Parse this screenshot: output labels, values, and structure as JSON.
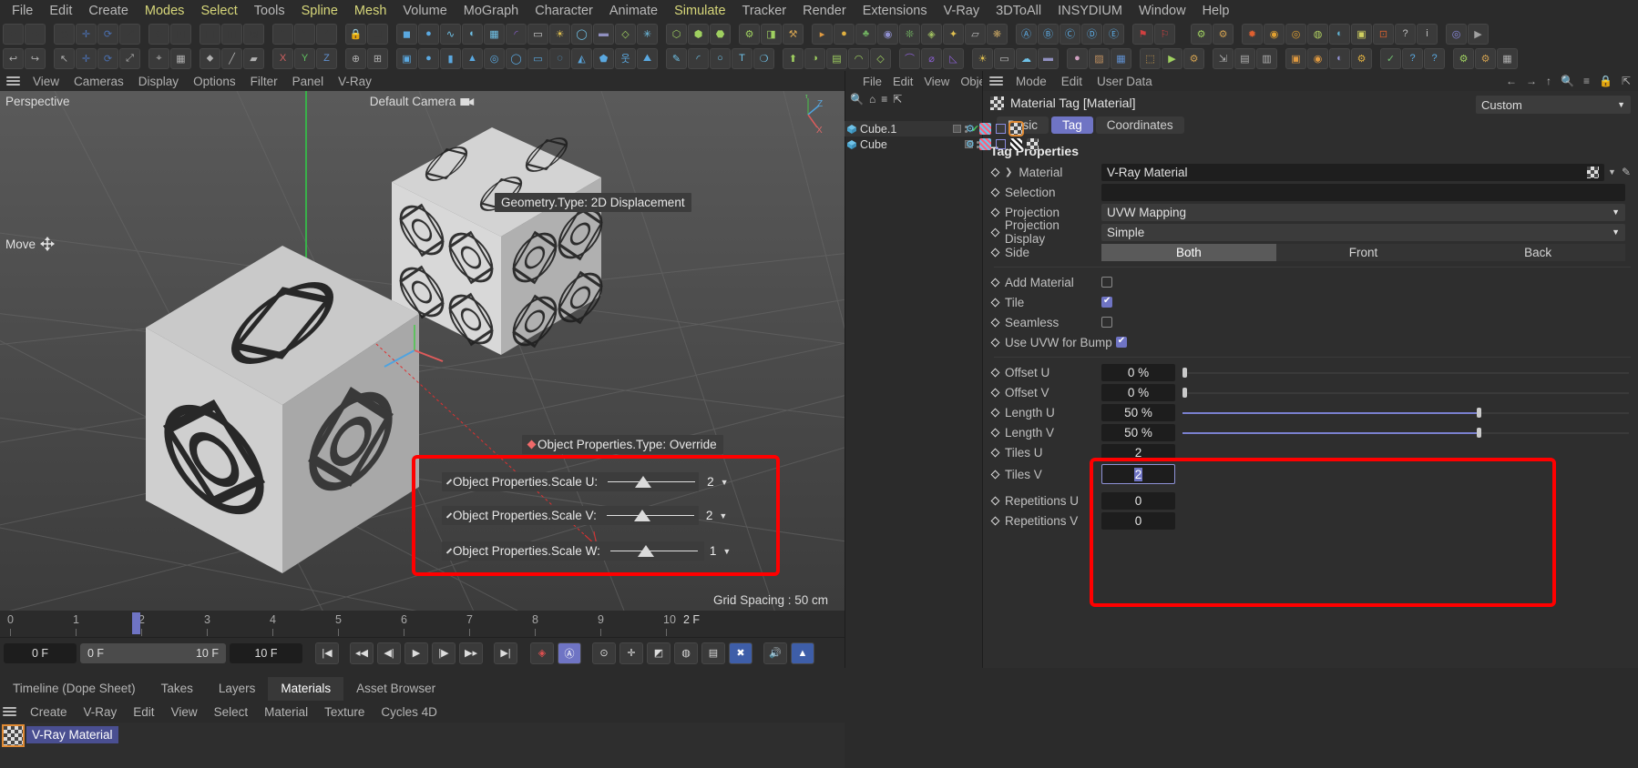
{
  "menubar": {
    "items": [
      {
        "label": "File",
        "accent": false
      },
      {
        "label": "Edit",
        "accent": false
      },
      {
        "label": "Create",
        "accent": false
      },
      {
        "label": "Modes",
        "accent": true
      },
      {
        "label": "Select",
        "accent": true
      },
      {
        "label": "Tools",
        "accent": false
      },
      {
        "label": "Spline",
        "accent": true
      },
      {
        "label": "Mesh",
        "accent": true
      },
      {
        "label": "Volume",
        "accent": false
      },
      {
        "label": "MoGraph",
        "accent": false
      },
      {
        "label": "Character",
        "accent": false
      },
      {
        "label": "Animate",
        "accent": false
      },
      {
        "label": "Simulate",
        "accent": true
      },
      {
        "label": "Tracker",
        "accent": false
      },
      {
        "label": "Render",
        "accent": false
      },
      {
        "label": "Extensions",
        "accent": false
      },
      {
        "label": "V-Ray",
        "accent": false
      },
      {
        "label": "3DToAll",
        "accent": false
      },
      {
        "label": "INSYDIUM",
        "accent": false
      },
      {
        "label": "Window",
        "accent": false
      },
      {
        "label": "Help",
        "accent": false
      }
    ]
  },
  "viewport_menu": {
    "items": [
      "View",
      "Cameras",
      "Display",
      "Options",
      "Filter",
      "Panel",
      "V-Ray"
    ]
  },
  "viewport": {
    "view_label": "Perspective",
    "camera_label": "Default Camera",
    "tool_label": "Move",
    "grid_spacing": "Grid Spacing : 50 cm",
    "axis_x": "X",
    "axis_y": "Y",
    "axis_z": "Z",
    "hud_geometry": "Geometry.Type: 2D Displacement",
    "hud_object_type": "Object Properties.Type: Override",
    "hud_sliders": [
      {
        "label": "Object Properties.Scale U:",
        "value": "2"
      },
      {
        "label": "Object Properties.Scale V:",
        "value": "2"
      },
      {
        "label": "Object Properties.Scale W:",
        "value": "1"
      }
    ]
  },
  "timeline": {
    "ticks": [
      "0",
      "1",
      "2",
      "3",
      "4",
      "5",
      "6",
      "7",
      "8",
      "9",
      "10"
    ],
    "end_label": "2 F",
    "current_frame": "0 F",
    "range_start": "0 F",
    "range_end": "10 F",
    "preview_end": "10 F"
  },
  "object_manager": {
    "menu": [
      "File",
      "Edit",
      "View",
      "Object"
    ],
    "chevron": "›",
    "icons": [
      "search-icon",
      "home-icon",
      "filter-icon",
      "popout-icon"
    ],
    "rows": [
      {
        "name": "Cube.1",
        "selected": true
      },
      {
        "name": "Cube",
        "selected": false
      }
    ]
  },
  "attribute_manager": {
    "menu": [
      "Mode",
      "Edit",
      "User Data"
    ],
    "nav_icons": [
      "back-arrow-icon",
      "forward-arrow-icon",
      "up-arrow-icon",
      "search-icon",
      "filter-icon",
      "lock-icon",
      "popout-icon"
    ],
    "title": "Material Tag [Material]",
    "preset_label": "Custom",
    "tabs": [
      {
        "label": "Basic",
        "active": false
      },
      {
        "label": "Tag",
        "active": true
      },
      {
        "label": "Coordinates",
        "active": false
      }
    ],
    "section_title": "Tag Properties",
    "fields": {
      "material": {
        "label": "Material",
        "value": "V-Ray Material"
      },
      "selection": {
        "label": "Selection",
        "value": ""
      },
      "projection": {
        "label": "Projection",
        "value": "UVW Mapping"
      },
      "projection_display": {
        "label": "Projection Display",
        "value": "Simple"
      },
      "side": {
        "label": "Side",
        "options": [
          "Both",
          "Front",
          "Back"
        ],
        "active": "Both"
      },
      "add_material": {
        "label": "Add Material",
        "checked": false
      },
      "tile": {
        "label": "Tile",
        "checked": true
      },
      "seamless": {
        "label": "Seamless",
        "checked": false
      },
      "use_uvw_for_bump": {
        "label": "Use UVW for Bump",
        "checked": true
      },
      "offset_u": {
        "label": "Offset U",
        "value": "0 %",
        "fill": 0
      },
      "offset_v": {
        "label": "Offset V",
        "value": "0 %",
        "fill": 0
      },
      "length_u": {
        "label": "Length U",
        "value": "50 %",
        "fill": 66
      },
      "length_v": {
        "label": "Length V",
        "value": "50 %",
        "fill": 66
      },
      "tiles_u": {
        "label": "Tiles U",
        "value": "2"
      },
      "tiles_v": {
        "label": "Tiles V",
        "value": "2",
        "focused": true
      },
      "repetitions_u": {
        "label": "Repetitions U",
        "value": "0"
      },
      "repetitions_v": {
        "label": "Repetitions V",
        "value": "0"
      }
    }
  },
  "bottom_tabs": [
    {
      "label": "Timeline (Dope Sheet)",
      "active": false
    },
    {
      "label": "Takes",
      "active": false
    },
    {
      "label": "Layers",
      "active": false
    },
    {
      "label": "Materials",
      "active": true
    },
    {
      "label": "Asset Browser",
      "active": false
    }
  ],
  "material_menu": [
    "Create",
    "V-Ray",
    "Edit",
    "View",
    "Select",
    "Material",
    "Texture",
    "Cycles 4D"
  ],
  "material": {
    "name": "V-Ray Material"
  },
  "colors": {
    "accent": "#6f74c4",
    "menu_accent": "#d7d77a",
    "highlight_box": "#ff0000",
    "panel_bg": "#2b2b2b",
    "field_bg": "#1d1d1d"
  }
}
